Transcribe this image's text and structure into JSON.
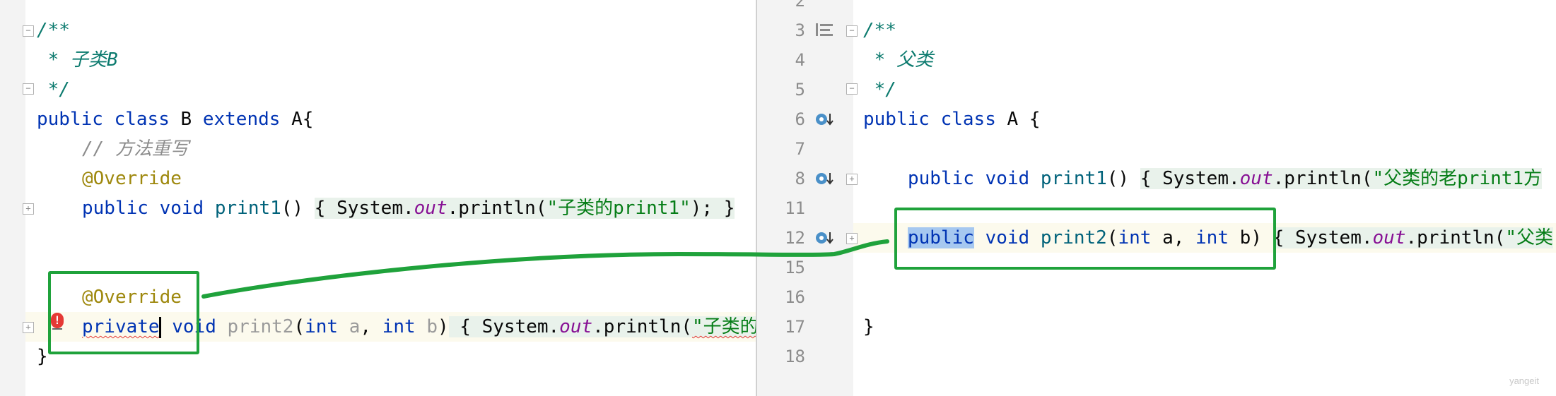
{
  "left_editor": {
    "doc_open": "/**",
    "doc_line": " * 子类B",
    "doc_close": " */",
    "class_decl": {
      "kw1": "public",
      "kw2": "class",
      "name": "B",
      "kw3": "extends",
      "parent": "A{"
    },
    "comment": "// 方法重写",
    "annotation1": "@Override",
    "print1": {
      "kw1": "public",
      "kw2": "void",
      "name": "print1",
      "parens": "()",
      "body_open": "{ ",
      "sys": "System.",
      "out": "out",
      "call": ".println(",
      "str": "\"子类的print1\"",
      "tail": "); }"
    },
    "annotation2": "@Override",
    "print2": {
      "kw1": "private",
      "kw2": "void",
      "name": "print2",
      "open": "(",
      "t1": "int",
      "p1": "a",
      "sep": ", ",
      "t2": "int",
      "p2": "b",
      "close": ")",
      "body_open": " { ",
      "sys": "System.",
      "out": "out",
      "call": ".println(",
      "str": "\"子类的"
    },
    "closing_brace": "}",
    "error_icon": "error-icon",
    "colors": {
      "highlight_box": "#1fa23b",
      "error": "#e53935"
    }
  },
  "right_editor": {
    "line_numbers": [
      "2",
      "3",
      "4",
      "5",
      "6",
      "7",
      "8",
      "11",
      "12",
      "15",
      "16",
      "17",
      "18"
    ],
    "doc_open": "/**",
    "doc_line": " * 父类",
    "doc_close": " */",
    "class_decl": {
      "kw1": "public",
      "kw2": "class",
      "name": "A",
      "brace": "{"
    },
    "print1": {
      "kw1": "public",
      "kw2": "void",
      "name": "print1",
      "parens": "()",
      "body_open": "{ ",
      "sys": "System.",
      "out": "out",
      "call": ".println(",
      "str": "\"父类的老print1方"
    },
    "print2": {
      "kw1": "public",
      "kw2": "void",
      "name": "print2",
      "open": "(",
      "t1": "int",
      "p1": "a",
      "sep": ", ",
      "t2": "int",
      "p2": "b",
      "close": ")",
      "body_open": "{ ",
      "sys": "System.",
      "out": "out",
      "call": ".println(",
      "str": "\"父类"
    },
    "closing_brace": "}",
    "override_icon": "overridden-method-icon"
  },
  "watermark": "yangeit"
}
